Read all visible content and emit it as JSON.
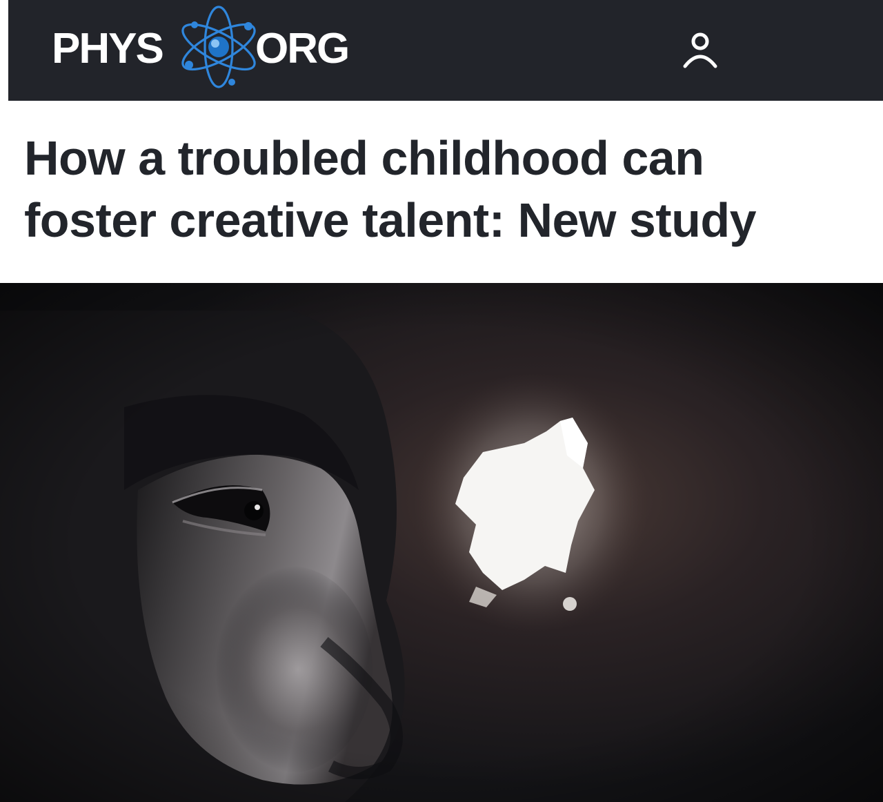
{
  "header": {
    "logo": {
      "part1": "PHYS",
      "part2": "ORG",
      "icon": "atom-icon",
      "accent_color": "#2a7fd4"
    },
    "account_icon": "user-icon",
    "background_color": "#22242a"
  },
  "article": {
    "title_line1": "How a troubled childhood can",
    "title_line2": "foster creative talent: New study",
    "hero_image": "photo-child-eye-peering-through-hole"
  }
}
